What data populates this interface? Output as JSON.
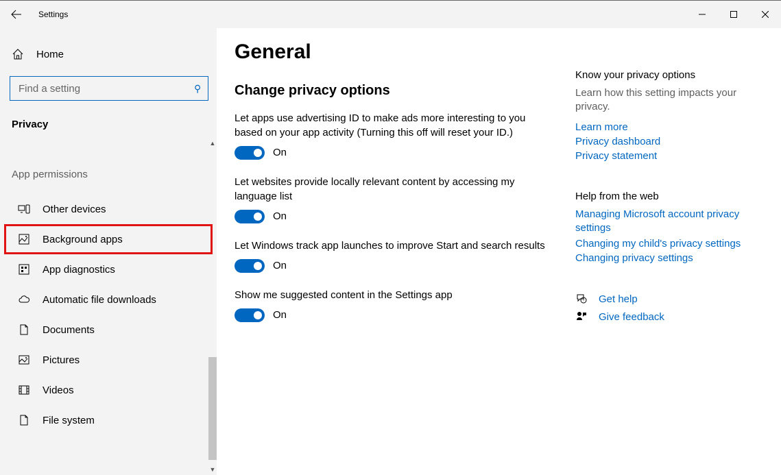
{
  "window": {
    "title": "Settings"
  },
  "sidebar": {
    "home": "Home",
    "search_placeholder": "Find a setting",
    "section": "Privacy",
    "subheader": "App permissions",
    "items": [
      {
        "label": "Other devices"
      },
      {
        "label": "Background apps"
      },
      {
        "label": "App diagnostics"
      },
      {
        "label": "Automatic file downloads"
      },
      {
        "label": "Documents"
      },
      {
        "label": "Pictures"
      },
      {
        "label": "Videos"
      },
      {
        "label": "File system"
      }
    ]
  },
  "main": {
    "title": "General",
    "subtitle": "Change privacy options",
    "settings": [
      {
        "desc": "Let apps use advertising ID to make ads more interesting to you based on your app activity (Turning this off will reset your ID.)",
        "state": "On"
      },
      {
        "desc": "Let websites provide locally relevant content by accessing my language list",
        "state": "On"
      },
      {
        "desc": "Let Windows track app launches to improve Start and search results",
        "state": "On"
      },
      {
        "desc": "Show me suggested content in the Settings app",
        "state": "On"
      }
    ]
  },
  "right": {
    "s1_head": "Know your privacy options",
    "s1_desc": "Learn how this setting impacts your privacy.",
    "s1_links": [
      "Learn more",
      "Privacy dashboard",
      "Privacy statement"
    ],
    "s2_head": "Help from the web",
    "s2_links": [
      "Managing Microsoft account privacy settings",
      "Changing my child's privacy settings",
      "Changing privacy settings"
    ],
    "help": "Get help",
    "feedback": "Give feedback"
  }
}
